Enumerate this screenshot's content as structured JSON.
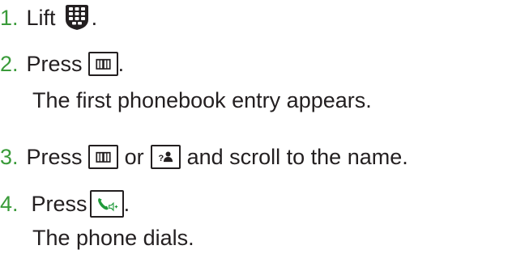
{
  "colors": {
    "step_number": "#3a9b3a",
    "call_key_green": "#1f9a3a",
    "text": "#231f20"
  },
  "steps": [
    {
      "number": "1.",
      "text_before": "Lift",
      "icon": "handset-keypad-icon",
      "text_after": "."
    },
    {
      "number": "2.",
      "text_before": "Press",
      "icon": "phonebook-key-icon",
      "text_after": ".",
      "note": "The first phonebook entry appears."
    },
    {
      "number": "3.",
      "text_before": "Press",
      "icon": "phonebook-key-icon",
      "connector": "or",
      "icon2": "contacts-key-icon",
      "text_after": "and scroll to the name."
    },
    {
      "number": "4.",
      "text_before": "Press",
      "icon": "call-handsfree-key-icon",
      "text_after": ".",
      "note": "The phone dials."
    }
  ]
}
